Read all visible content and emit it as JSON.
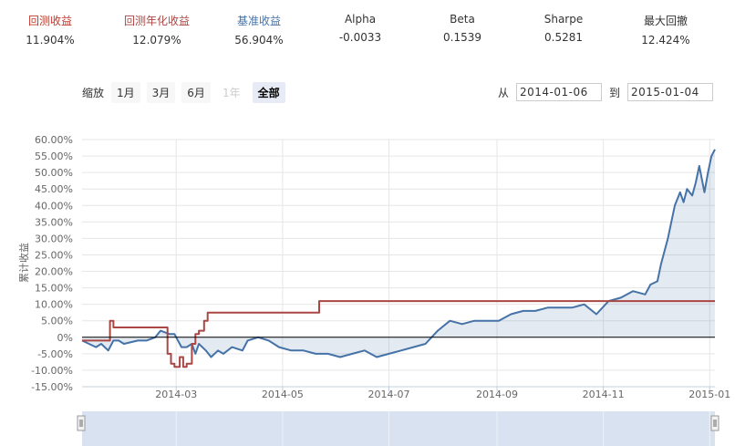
{
  "stats": [
    {
      "label": "回测收益",
      "value": "11.904%",
      "color": "#c0392b"
    },
    {
      "label": "回测年化收益",
      "value": "12.079%",
      "color": "#aa4643"
    },
    {
      "label": "基准收益",
      "value": "56.904%",
      "color": "#4572a7"
    },
    {
      "label": "Alpha",
      "value": "-0.0033",
      "color": "#333333"
    },
    {
      "label": "Beta",
      "value": "0.1539",
      "color": "#333333"
    },
    {
      "label": "Sharpe",
      "value": "0.5281",
      "color": "#333333"
    },
    {
      "label": "最大回撤",
      "value": "12.424%",
      "color": "#333333"
    }
  ],
  "zoom": {
    "label": "缩放",
    "buttons": [
      {
        "label": "1月",
        "state": "normal"
      },
      {
        "label": "3月",
        "state": "normal"
      },
      {
        "label": "6月",
        "state": "normal"
      },
      {
        "label": "1年",
        "state": "disabled"
      },
      {
        "label": "全部",
        "state": "active"
      }
    ]
  },
  "range": {
    "from_label": "从",
    "from": "2014-01-06",
    "to_label": "到",
    "to": "2015-01-04"
  },
  "chart_data": {
    "type": "line",
    "ylabel": "累计收益",
    "ylim": [
      -15,
      60
    ],
    "y_ticks": [
      "60.00%",
      "55.00%",
      "50.00%",
      "45.00%",
      "40.00%",
      "35.00%",
      "30.00%",
      "25.00%",
      "20.00%",
      "15.00%",
      "10.00%",
      "5.00%",
      "0%",
      "-5.00%",
      "-10.00%",
      "-15.00%"
    ],
    "x_ticks": [
      "2014-03",
      "2014-05",
      "2014-07",
      "2014-09",
      "2014-11",
      "2015-01"
    ],
    "grid": true,
    "legend": "none",
    "series": [
      {
        "color": "#aa4643",
        "area": false,
        "x": [
          "2014-01-06",
          "2014-01-14",
          "2014-01-20",
          "2014-01-22",
          "2014-01-24",
          "2014-01-28",
          "2014-02-10",
          "2014-02-18",
          "2014-02-21",
          "2014-02-24",
          "2014-02-26",
          "2014-02-28",
          "2014-03-03",
          "2014-03-05",
          "2014-03-07",
          "2014-03-10",
          "2014-03-12",
          "2014-03-14",
          "2014-03-17",
          "2014-03-19",
          "2014-05-20",
          "2014-05-22",
          "2015-01-04"
        ],
        "y": [
          -1,
          -1,
          -1,
          5,
          3,
          3,
          3,
          3,
          3,
          -5,
          -8,
          -9,
          -6,
          -9,
          -8,
          -2,
          1,
          2,
          5,
          7.5,
          7.5,
          11,
          11
        ]
      },
      {
        "color": "#4572a7",
        "area": true,
        "x": [
          "2014-01-06",
          "2014-01-10",
          "2014-01-14",
          "2014-01-17",
          "2014-01-21",
          "2014-01-24",
          "2014-01-27",
          "2014-01-30",
          "2014-02-07",
          "2014-02-12",
          "2014-02-17",
          "2014-02-20",
          "2014-02-25",
          "2014-02-28",
          "2014-03-04",
          "2014-03-07",
          "2014-03-10",
          "2014-03-12",
          "2014-03-14",
          "2014-03-18",
          "2014-03-21",
          "2014-03-25",
          "2014-03-28",
          "2014-04-02",
          "2014-04-08",
          "2014-04-11",
          "2014-04-17",
          "2014-04-23",
          "2014-04-29",
          "2014-05-06",
          "2014-05-13",
          "2014-05-20",
          "2014-05-27",
          "2014-06-03",
          "2014-06-10",
          "2014-06-17",
          "2014-06-24",
          "2014-07-01",
          "2014-07-08",
          "2014-07-15",
          "2014-07-22",
          "2014-07-29",
          "2014-08-05",
          "2014-08-12",
          "2014-08-19",
          "2014-08-26",
          "2014-09-02",
          "2014-09-09",
          "2014-09-16",
          "2014-09-23",
          "2014-09-30",
          "2014-10-14",
          "2014-10-21",
          "2014-10-28",
          "2014-11-04",
          "2014-11-11",
          "2014-11-18",
          "2014-11-25",
          "2014-11-28",
          "2014-12-02",
          "2014-12-04",
          "2014-12-08",
          "2014-12-10",
          "2014-12-12",
          "2014-12-15",
          "2014-12-17",
          "2014-12-19",
          "2014-12-22",
          "2014-12-24",
          "2014-12-26",
          "2014-12-29",
          "2014-12-31",
          "2015-01-02",
          "2015-01-04"
        ],
        "y": [
          -1,
          -2,
          -3,
          -2,
          -4,
          -1,
          -1,
          -2,
          -1,
          -1,
          0,
          2,
          1,
          1,
          -3,
          -3,
          -2,
          -5,
          -2,
          -4,
          -6,
          -4,
          -5,
          -3,
          -4,
          -1,
          0,
          -1,
          -3,
          -4,
          -4,
          -5,
          -5,
          -6,
          -5,
          -4,
          -6,
          -5,
          -4,
          -3,
          -2,
          2,
          5,
          4,
          5,
          5,
          5,
          7,
          8,
          8,
          9,
          9,
          10,
          7,
          11,
          12,
          14,
          13,
          16,
          17,
          22,
          30,
          35,
          40,
          44,
          41,
          45,
          43,
          47,
          52,
          44,
          50,
          55,
          57
        ]
      }
    ]
  }
}
